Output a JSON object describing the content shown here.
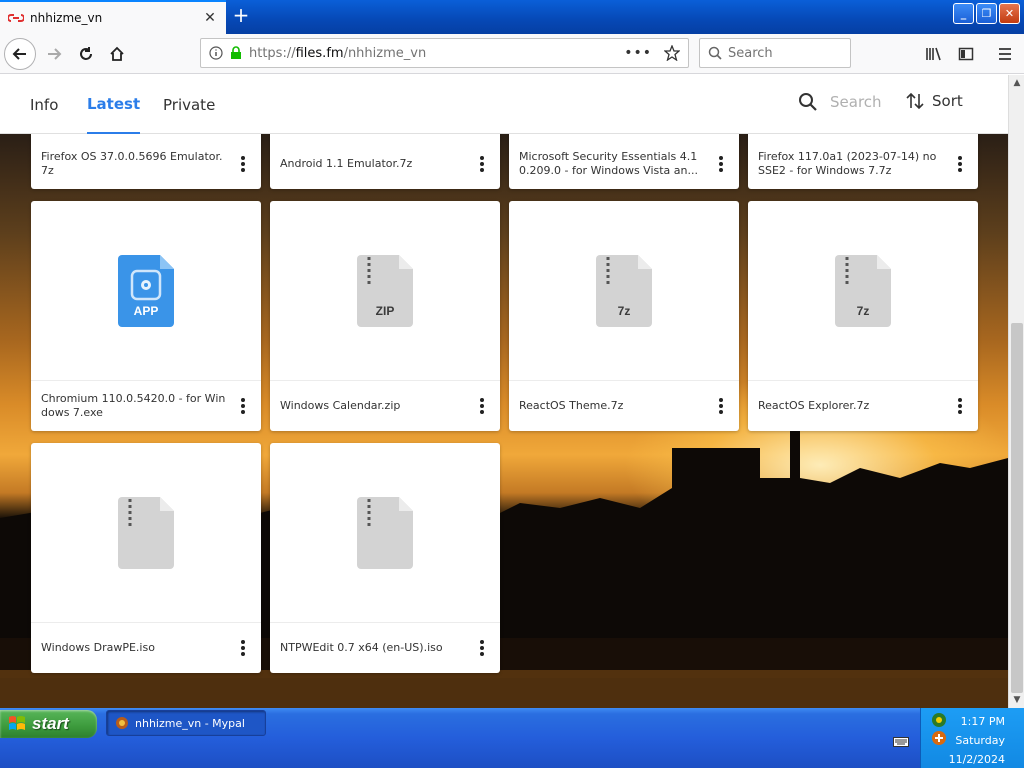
{
  "browser": {
    "tab_title": "nhhizme_vn",
    "url_prefix": "https://",
    "url_host": "files.fm",
    "url_path": "/nhhizme_vn",
    "search_placeholder": "Search"
  },
  "site": {
    "nav_tabs": [
      "Info",
      "Latest",
      "Private"
    ],
    "active_tab": "Latest",
    "search_placeholder": "Search",
    "sort_label": "Sort"
  },
  "files": [
    {
      "name": "Firefox OS 37.0.0.5696 Emulator.7z",
      "icon": "archive-7z-icon"
    },
    {
      "name": "Android 1.1 Emulator.7z",
      "icon": "archive-7z-icon"
    },
    {
      "name": "Microsoft Security Essentials 4.10.209.0 - for Windows Vista an...",
      "icon": "archive-7z-icon"
    },
    {
      "name": "Firefox 117.0a1 (2023-07-14) no SSE2 - for Windows 7.7z",
      "icon": "archive-7z-icon"
    },
    {
      "name": "Chromium 110.0.5420.0 - for Windows 7.exe",
      "icon": "app-icon",
      "icon_label": "APP"
    },
    {
      "name": "Windows Calendar.zip",
      "icon": "archive-zip-icon",
      "icon_label": "ZIP"
    },
    {
      "name": "ReactOS Theme.7z",
      "icon": "archive-7z-icon",
      "icon_label": "7z"
    },
    {
      "name": "ReactOS Explorer.7z",
      "icon": "archive-7z-icon",
      "icon_label": "7z"
    },
    {
      "name": "Windows DrawPE.iso",
      "icon": "archive-icon",
      "icon_label": ""
    },
    {
      "name": "NTPWEdit 0.7 x64 (en-US).iso",
      "icon": "archive-icon",
      "icon_label": ""
    }
  ],
  "taskbar": {
    "start_label": "start",
    "window_item": "nhhizme_vn - Mypal",
    "clock_time": "1:17 PM",
    "clock_day": "Saturday",
    "clock_date": "11/2/2024"
  },
  "colors": {
    "accent": "#2b7de9",
    "app_icon": "#3a94e8",
    "archive_icon": "#d3d3d3",
    "taskbar": "#245edb",
    "start_green": "#3c9a3c"
  }
}
